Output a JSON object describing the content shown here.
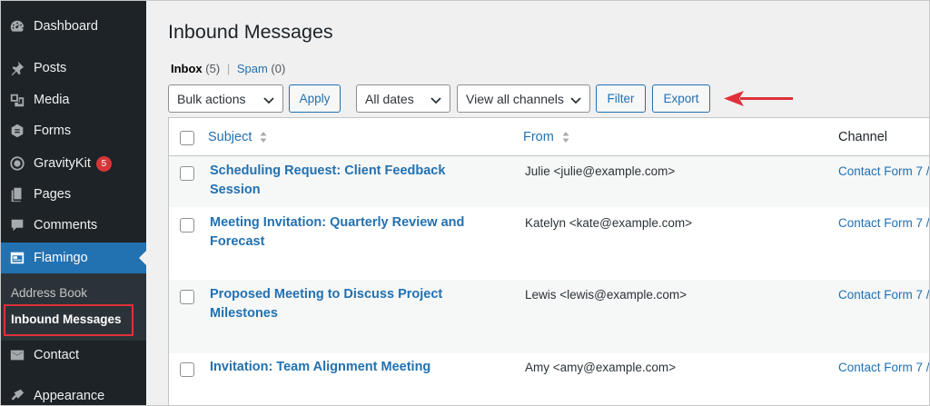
{
  "sidebar": {
    "items": [
      {
        "label": "Dashboard",
        "icon": "dashboard-icon"
      },
      {
        "label": "Posts",
        "icon": "pin-icon"
      },
      {
        "label": "Media",
        "icon": "media-icon"
      },
      {
        "label": "Forms",
        "icon": "forms-icon"
      },
      {
        "label": "GravityKit",
        "icon": "gravitykit-icon",
        "badge": "5"
      },
      {
        "label": "Pages",
        "icon": "pages-icon"
      },
      {
        "label": "Comments",
        "icon": "comments-icon"
      },
      {
        "label": "Flamingo",
        "icon": "flamingo-icon"
      },
      {
        "label": "Contact",
        "icon": "mail-icon"
      },
      {
        "label": "Appearance",
        "icon": "brush-icon"
      }
    ],
    "submenu": [
      {
        "label": "Address Book"
      },
      {
        "label": "Inbound Messages"
      }
    ]
  },
  "page": {
    "title": "Inbound Messages",
    "views": {
      "inbox_label": "Inbox",
      "inbox_count": "(5)",
      "separator": "|",
      "spam_label": "Spam",
      "spam_count": "(0)"
    }
  },
  "toolbar": {
    "bulk_actions": "Bulk actions",
    "apply": "Apply",
    "dates": "All dates",
    "channels": "View all channels",
    "filter": "Filter",
    "export": "Export"
  },
  "table": {
    "columns": {
      "subject": "Subject",
      "from": "From",
      "channel": "Channel"
    },
    "rows": [
      {
        "subject": "Scheduling Request: Client Feedback Session",
        "from": "Julie <julie@example.com>",
        "channel": "Contact Form 7 /"
      },
      {
        "subject": "Meeting Invitation: Quarterly Review and Forecast",
        "from": "Katelyn <kate@example.com>",
        "channel": "Contact Form 7 /"
      },
      {
        "subject": "Proposed Meeting to Discuss Project Milestones",
        "from": "Lewis <lewis@example.com>",
        "channel": "Contact Form 7 /"
      },
      {
        "subject": "Invitation: Team Alignment Meeting",
        "from": "Amy <amy@example.com>",
        "channel": "Contact Form 7 /"
      }
    ]
  },
  "colors": {
    "sidebar_bg": "#1d2327",
    "accent": "#2271b1",
    "annotation_red": "#e0313a",
    "badge_red": "#d63638"
  }
}
